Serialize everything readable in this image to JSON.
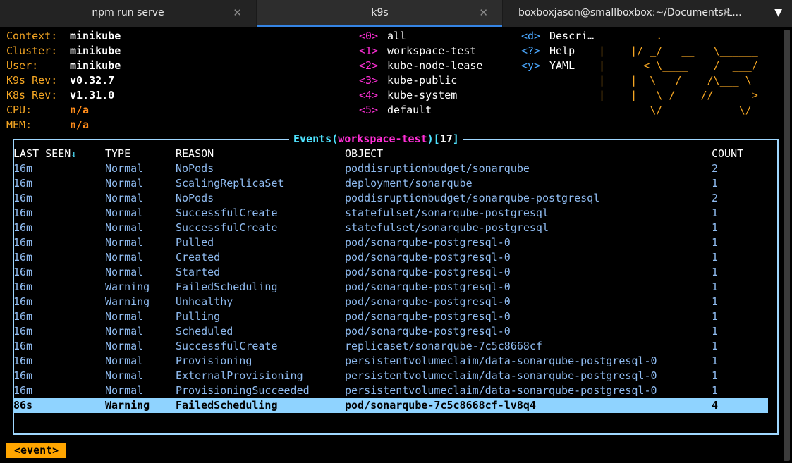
{
  "tabs": [
    {
      "title": "npm run serve",
      "close": "✕"
    },
    {
      "title": "k9s",
      "close": "✕"
    },
    {
      "title": "boxboxjason@smallboxbox:~/Documents/L...",
      "close": "✕"
    }
  ],
  "tabs_menu_icon": "chevron-down-icon",
  "info": [
    {
      "label": "Context:",
      "value": "minikube"
    },
    {
      "label": "Cluster:",
      "value": "minikube"
    },
    {
      "label": "User:",
      "value": "minikube"
    },
    {
      "label": "K9s Rev:",
      "value": "v0.32.7"
    },
    {
      "label": "K8s Rev:",
      "value": "v1.31.0"
    },
    {
      "label": "CPU:",
      "value": "n/a"
    },
    {
      "label": "MEM:",
      "value": "n/a"
    }
  ],
  "namespaces": [
    {
      "key": "<0>",
      "name": "all"
    },
    {
      "key": "<1>",
      "name": "workspace-test"
    },
    {
      "key": "<2>",
      "name": "kube-node-lease"
    },
    {
      "key": "<3>",
      "name": "kube-public"
    },
    {
      "key": "<4>",
      "name": "kube-system"
    },
    {
      "key": "<5>",
      "name": "default"
    }
  ],
  "hints": [
    {
      "key": "<d>",
      "label": "Descri…"
    },
    {
      "key": "<?>",
      "label": "Help"
    },
    {
      "key": "<y>",
      "label": "YAML"
    }
  ],
  "logo_lines": [
    " ____  __.________       ",
    "|    |/ _/   __   \\______",
    "|      < \\____    /  ___/",
    "|    |  \\   /    /\\___ \\ ",
    "|____|__ \\ /____//____  >",
    "        \\/            \\/ "
  ],
  "events": {
    "title": "Events",
    "namespace": "workspace-test",
    "count": "17",
    "columns": [
      "LAST SEEN",
      "TYPE",
      "REASON",
      "OBJECT",
      "COUNT"
    ],
    "sort_indicator": "↓",
    "rows": [
      [
        "16m",
        "Normal",
        "NoPods",
        "poddisruptionbudget/sonarqube",
        "2"
      ],
      [
        "16m",
        "Normal",
        "ScalingReplicaSet",
        "deployment/sonarqube",
        "1"
      ],
      [
        "16m",
        "Normal",
        "NoPods",
        "poddisruptionbudget/sonarqube-postgresql",
        "2"
      ],
      [
        "16m",
        "Normal",
        "SuccessfulCreate",
        "statefulset/sonarqube-postgresql",
        "1"
      ],
      [
        "16m",
        "Normal",
        "SuccessfulCreate",
        "statefulset/sonarqube-postgresql",
        "1"
      ],
      [
        "16m",
        "Normal",
        "Pulled",
        "pod/sonarqube-postgresql-0",
        "1"
      ],
      [
        "16m",
        "Normal",
        "Created",
        "pod/sonarqube-postgresql-0",
        "1"
      ],
      [
        "16m",
        "Normal",
        "Started",
        "pod/sonarqube-postgresql-0",
        "1"
      ],
      [
        "16m",
        "Warning",
        "FailedScheduling",
        "pod/sonarqube-postgresql-0",
        "1"
      ],
      [
        "16m",
        "Warning",
        "Unhealthy",
        "pod/sonarqube-postgresql-0",
        "1"
      ],
      [
        "16m",
        "Normal",
        "Pulling",
        "pod/sonarqube-postgresql-0",
        "1"
      ],
      [
        "16m",
        "Normal",
        "Scheduled",
        "pod/sonarqube-postgresql-0",
        "1"
      ],
      [
        "16m",
        "Normal",
        "SuccessfulCreate",
        "replicaset/sonarqube-7c5c8668cf",
        "1"
      ],
      [
        "16m",
        "Normal",
        "Provisioning",
        "persistentvolumeclaim/data-sonarqube-postgresql-0",
        "1"
      ],
      [
        "16m",
        "Normal",
        "ExternalProvisioning",
        "persistentvolumeclaim/data-sonarqube-postgresql-0",
        "1"
      ],
      [
        "16m",
        "Normal",
        "ProvisioningSucceeded",
        "persistentvolumeclaim/data-sonarqube-postgresql-0",
        "1"
      ],
      [
        "86s",
        "Warning",
        "FailedScheduling",
        "pod/sonarqube-7c5c8668cf-lv8q4",
        "4"
      ]
    ],
    "selected_row": 16
  },
  "breadcrumb": "<event>"
}
